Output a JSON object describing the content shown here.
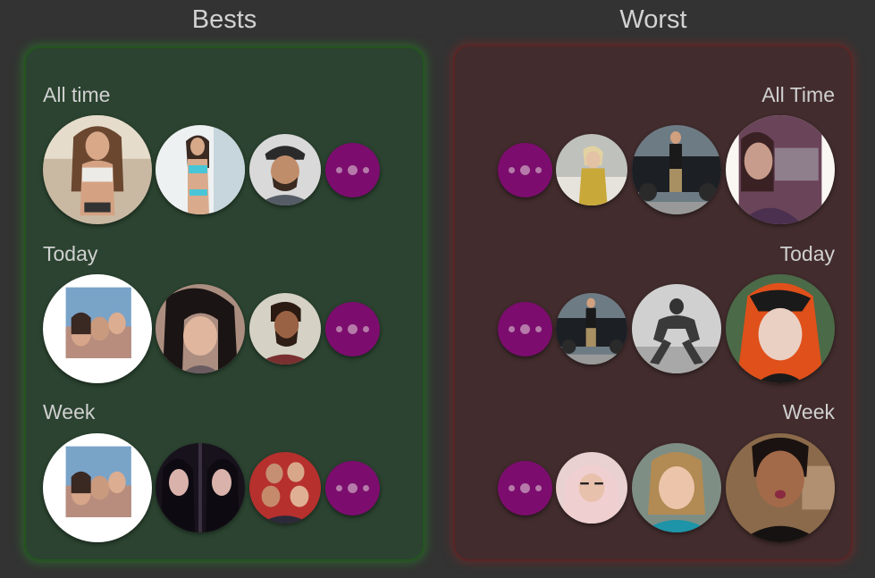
{
  "headers": {
    "best": "Bests",
    "worst": "Worst"
  },
  "best": {
    "sections": [
      {
        "label": "All time"
      },
      {
        "label": "Today"
      },
      {
        "label": "Week"
      }
    ]
  },
  "worst": {
    "sections": [
      {
        "label": "All Time"
      },
      {
        "label": "Today"
      },
      {
        "label": "Week"
      }
    ]
  },
  "colors": {
    "background": "#333333",
    "best_panel": "#2b4330",
    "best_glow": "#24541f",
    "worst_panel": "#422c2d",
    "worst_glow": "#5a2525",
    "more_button": "#7c0d6e",
    "more_button_dots": "#b57aa9",
    "text": "#d0d0d0"
  },
  "icons": {
    "more": "more-dots-icon"
  }
}
